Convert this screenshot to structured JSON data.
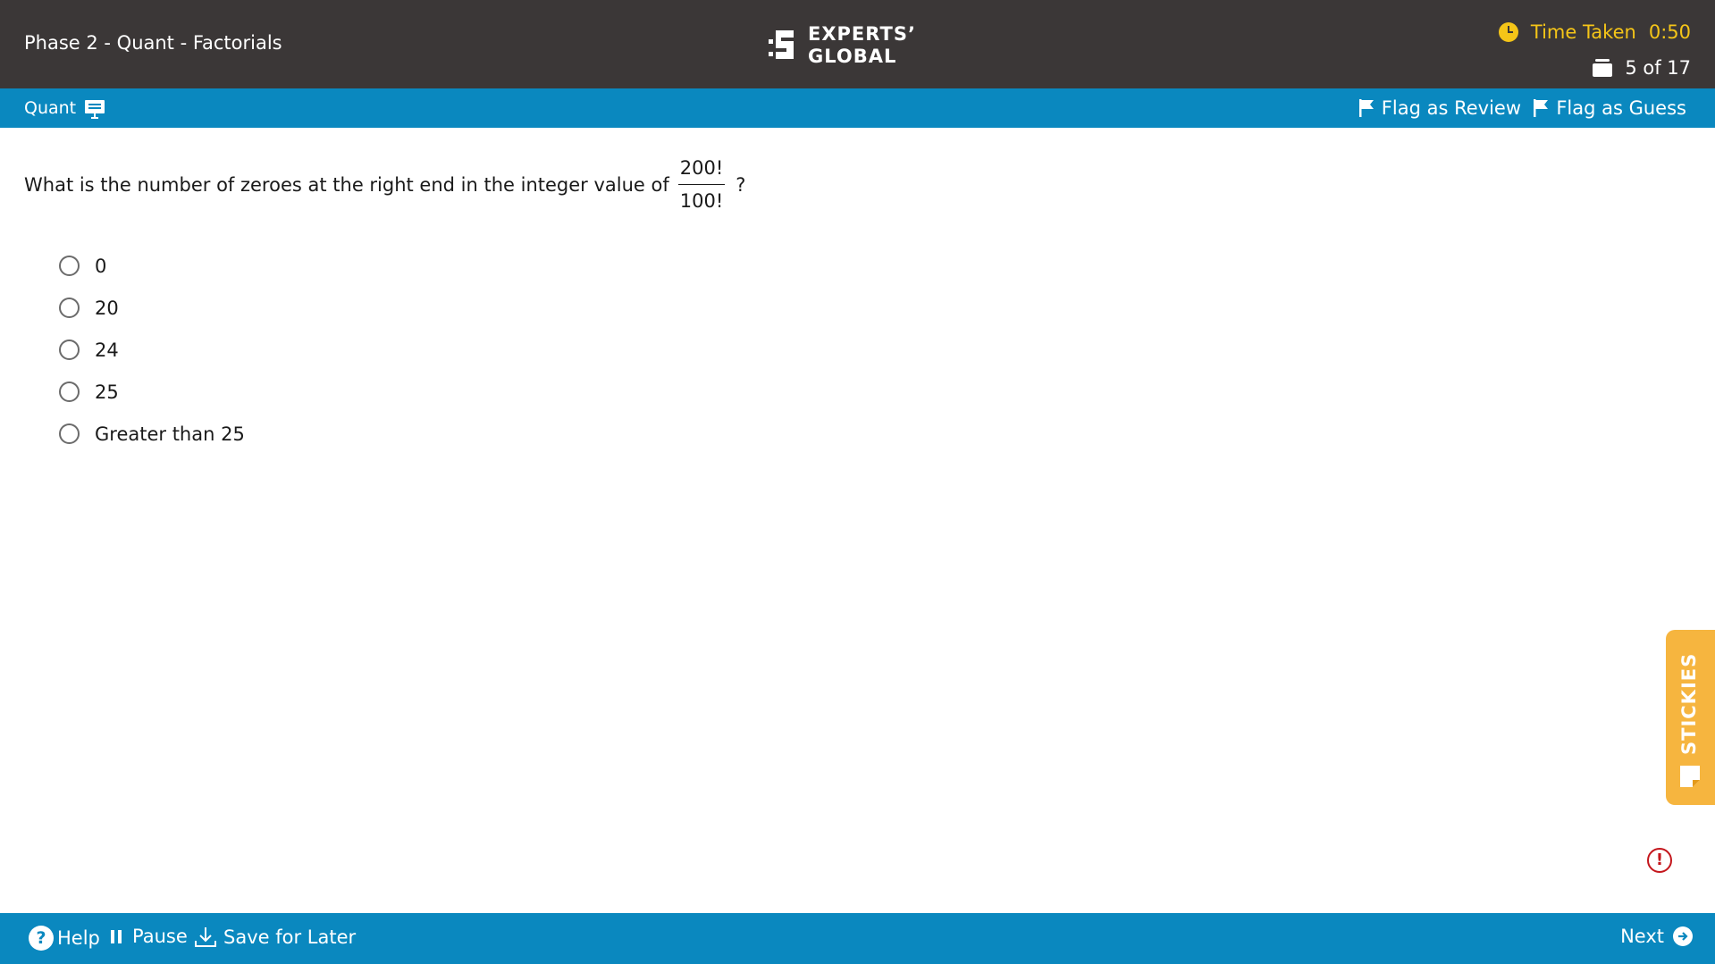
{
  "header": {
    "exam_title": "Phase 2 - Quant - Factorials",
    "logo_line1": "EXPERTS’",
    "logo_line2": "GLOBAL",
    "timer_label": "Time Taken",
    "timer_value": "0:50",
    "progress": "5 of 17"
  },
  "section_bar": {
    "section": "Quant",
    "flag_review": "Flag as Review",
    "flag_guess": "Flag as Guess"
  },
  "question": {
    "prefix": "What is the number of zeroes at the right end in the integer value of",
    "numerator": "200!",
    "denominator": "100!",
    "suffix": "?",
    "options": [
      "0",
      "20",
      "24",
      "25",
      "Greater than 25"
    ]
  },
  "stickies": {
    "label": "STICKIES"
  },
  "alert": {
    "symbol": "!"
  },
  "footer": {
    "help": "Help",
    "pause": "Pause",
    "save": "Save for Later",
    "next": "Next"
  },
  "colors": {
    "header_bg": "#3b3737",
    "bar_blue": "#0a88bf",
    "timer_yellow": "#f5c518",
    "stickies_orange": "#f6b53f",
    "alert_red": "#c4161c"
  }
}
